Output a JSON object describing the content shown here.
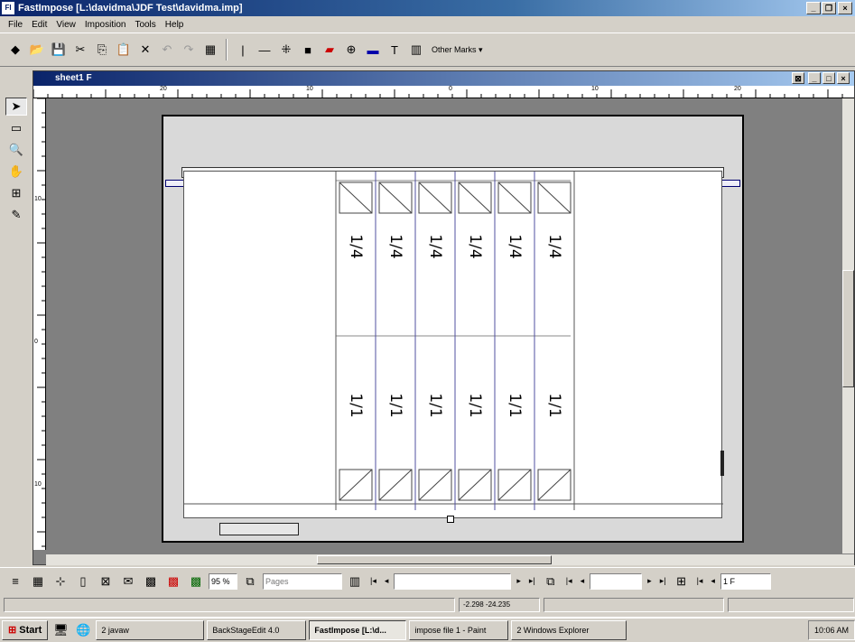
{
  "window": {
    "title": "FastImpose [L:\\davidma\\JDF Test\\davidma.imp]",
    "icon": "fastimpose-icon"
  },
  "menu": [
    "File",
    "Edit",
    "View",
    "Imposition",
    "Tools",
    "Help"
  ],
  "toolbar": {
    "other_marks": "Other Marks ▾"
  },
  "document": {
    "title": "sheet1 F"
  },
  "ruler": {
    "top": [
      "20",
      "10",
      "0",
      "10",
      "20"
    ],
    "left": [
      "10",
      "0",
      "10"
    ]
  },
  "pages": {
    "top_label": "1/4",
    "bottom_label": "1/1",
    "columns": 6
  },
  "bottom": {
    "zoom": "95 %",
    "pages": "Pages",
    "sheet": "1 F"
  },
  "status": {
    "coords": "-2.298  -24.235"
  },
  "taskbar": {
    "start": "Start",
    "tasks": [
      "2 javaw",
      "BackStageEdit 4.0",
      "FastImpose [L:\\d...",
      "impose file 1 - Paint",
      "2 Windows Explorer"
    ],
    "clock": "10:06 AM"
  }
}
